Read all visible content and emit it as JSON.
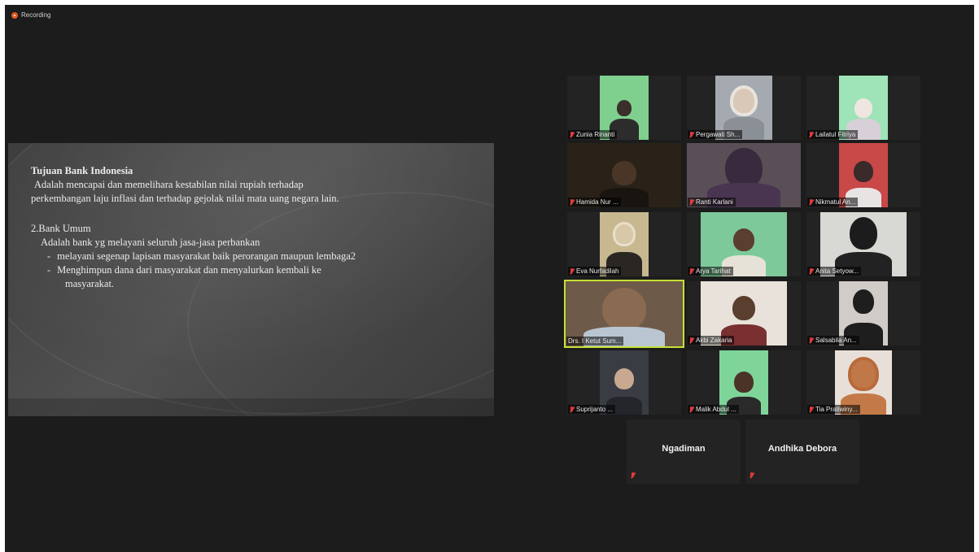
{
  "recording": {
    "label": "Recording"
  },
  "slide": {
    "title": "Tujuan Bank Indonesia",
    "line1": "Adalah mencapai dan memelihara kestabilan nilai rupiah terhadap",
    "line2": "perkembangan laju inflasi dan terhadap gejolak nilai mata uang negara lain.",
    "section2_title": "2.Bank Umum",
    "section2_desc": "Adalah bank yg melayani seluruh jasa-jasa perbankan",
    "bullet1": "melayani segenap lapisan masyarakat baik perorangan maupun lembaga2",
    "bullet2": "Menghimpun dana dari masyarakat dan menyalurkan kembali ke",
    "bullet2_cont": "masyarakat.",
    "bullet_marker": "-"
  },
  "participants": [
    {
      "name": "Zunia Rinanti"
    },
    {
      "name": "Pergawati Sh..."
    },
    {
      "name": "Lailatul Fitriya"
    },
    {
      "name": "Hamida Nur ..."
    },
    {
      "name": "Ranti Karlani"
    },
    {
      "name": "Nikmatul An..."
    },
    {
      "name": "Eva Nurfadilah"
    },
    {
      "name": "Arya Tarihat"
    },
    {
      "name": "Anita Setyow..."
    },
    {
      "name": "Drs. I Ketut Sum..."
    },
    {
      "name": "Akbi Zakaria"
    },
    {
      "name": "Salsabila An..."
    },
    {
      "name": "Suprijanto ..."
    },
    {
      "name": "Malik Abdul ..."
    },
    {
      "name": "Tia Pratiwiny..."
    }
  ],
  "audio_participants": [
    {
      "name": "Ngadiman"
    },
    {
      "name": "Andhika Debora"
    }
  ],
  "colors": {
    "active_speaker": "#c6e034",
    "muted_mic": "#e23b3b",
    "recording_dot": "#e05a1e"
  }
}
